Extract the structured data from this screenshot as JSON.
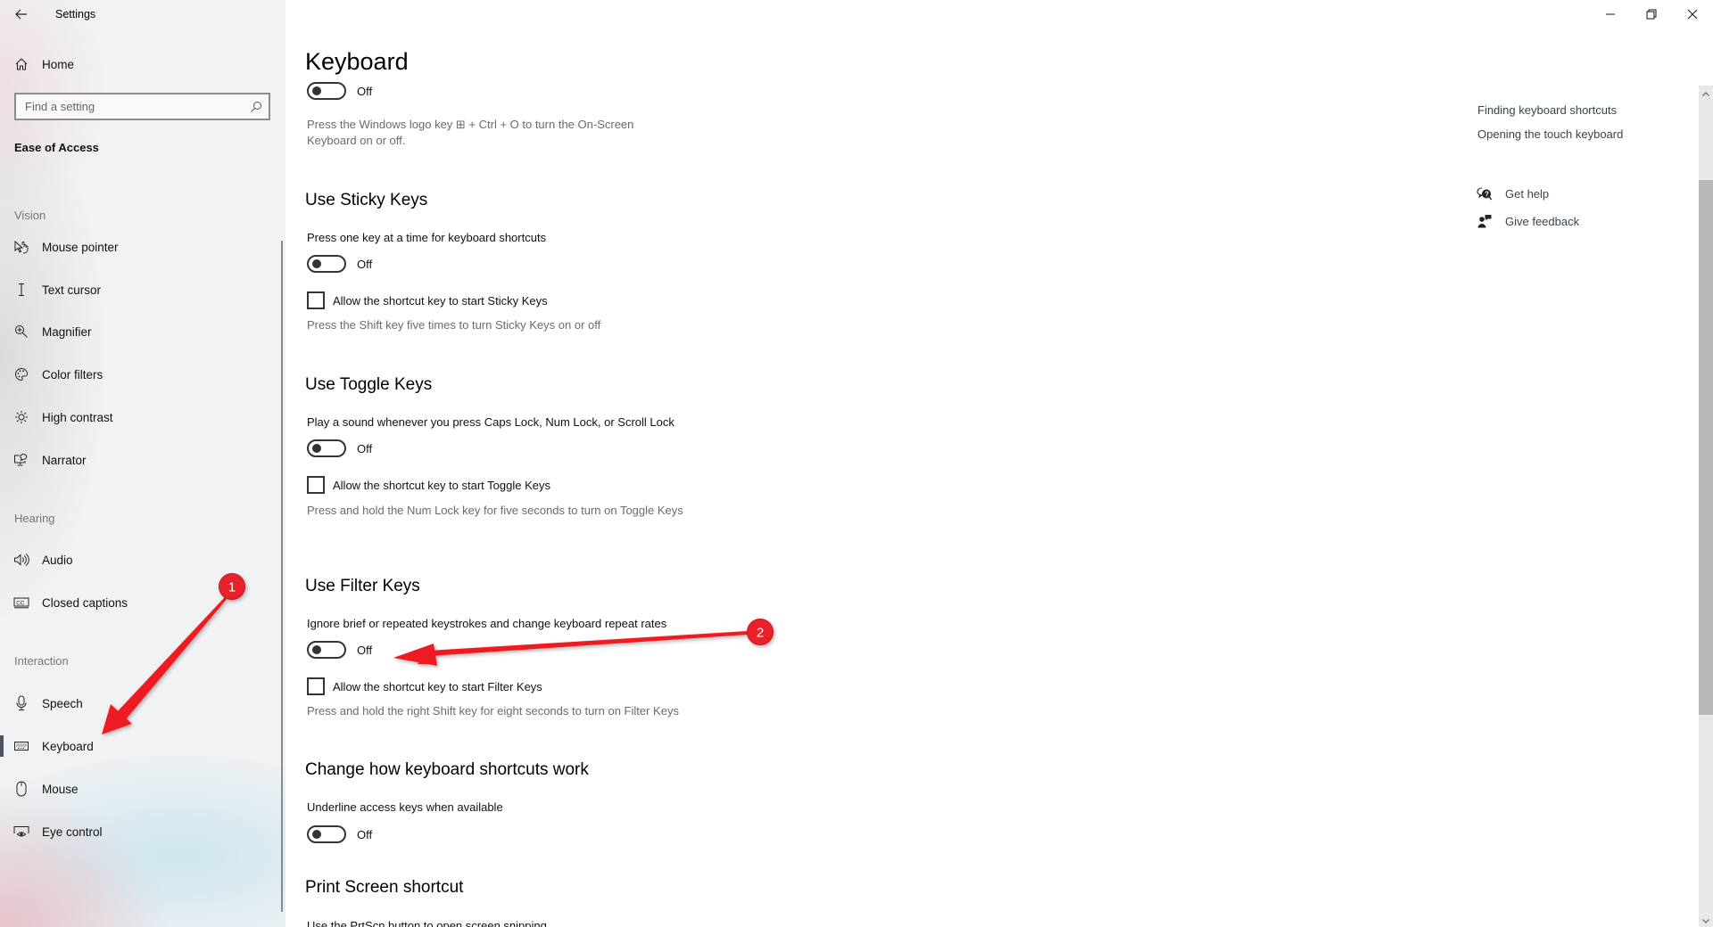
{
  "window": {
    "title": "Settings",
    "back_label": "Back",
    "controls": [
      "minimize",
      "restore",
      "close"
    ]
  },
  "sidebar": {
    "home_label": "Home",
    "search": {
      "placeholder": "Find a setting",
      "value": ""
    },
    "section_title": "Ease of Access",
    "groups": [
      {
        "label": "Vision",
        "items": [
          {
            "label": "Mouse pointer",
            "icon": "mouse-pointer-icon"
          },
          {
            "label": "Text cursor",
            "icon": "text-cursor-icon"
          },
          {
            "label": "Magnifier",
            "icon": "magnifier-icon"
          },
          {
            "label": "Color filters",
            "icon": "palette-icon"
          },
          {
            "label": "High contrast",
            "icon": "brightness-icon"
          },
          {
            "label": "Narrator",
            "icon": "narrator-icon"
          }
        ]
      },
      {
        "label": "Hearing",
        "items": [
          {
            "label": "Audio",
            "icon": "speaker-icon"
          },
          {
            "label": "Closed captions",
            "icon": "closed-captions-icon"
          }
        ]
      },
      {
        "label": "Interaction",
        "items": [
          {
            "label": "Speech",
            "icon": "microphone-icon"
          },
          {
            "label": "Keyboard",
            "icon": "keyboard-icon",
            "selected": true
          },
          {
            "label": "Mouse",
            "icon": "mouse-icon"
          },
          {
            "label": "Eye control",
            "icon": "eye-control-icon"
          }
        ]
      }
    ]
  },
  "main": {
    "page_title": "Keyboard",
    "onscreen": {
      "toggle_state": "Off",
      "hint": "Press the Windows logo key ⊞ + Ctrl + O to turn the On-Screen Keyboard on or off."
    },
    "sticky_keys": {
      "heading": "Use Sticky Keys",
      "description": "Press one key at a time for keyboard shortcuts",
      "toggle_state": "Off",
      "checkbox_label": "Allow the shortcut key to start Sticky Keys",
      "checkbox_checked": false,
      "hint": "Press the Shift key five times to turn Sticky Keys on or off"
    },
    "toggle_keys": {
      "heading": "Use Toggle Keys",
      "description": "Play a sound whenever you press Caps Lock, Num Lock, or Scroll Lock",
      "toggle_state": "Off",
      "checkbox_label": "Allow the shortcut key to start Toggle Keys",
      "checkbox_checked": false,
      "hint": "Press and hold the Num Lock key for five seconds to turn on Toggle Keys"
    },
    "filter_keys": {
      "heading": "Use Filter Keys",
      "description": "Ignore brief or repeated keystrokes and change keyboard repeat rates",
      "toggle_state": "Off",
      "checkbox_label": "Allow the shortcut key to start Filter Keys",
      "checkbox_checked": false,
      "hint": "Press and hold the right Shift key for eight seconds to turn on Filter Keys"
    },
    "shortcuts": {
      "heading": "Change how keyboard shortcuts work",
      "description": "Underline access keys when available",
      "toggle_state": "Off"
    },
    "print_screen": {
      "heading": "Print Screen shortcut",
      "description": "Use the PrtScn button to open screen snipping"
    }
  },
  "related": {
    "links": [
      "Finding keyboard shortcuts",
      "Opening the touch keyboard"
    ],
    "get_help": "Get help",
    "give_feedback": "Give feedback"
  },
  "annotations": {
    "badge_1": "1",
    "badge_2": "2",
    "color": "#e8212b"
  }
}
